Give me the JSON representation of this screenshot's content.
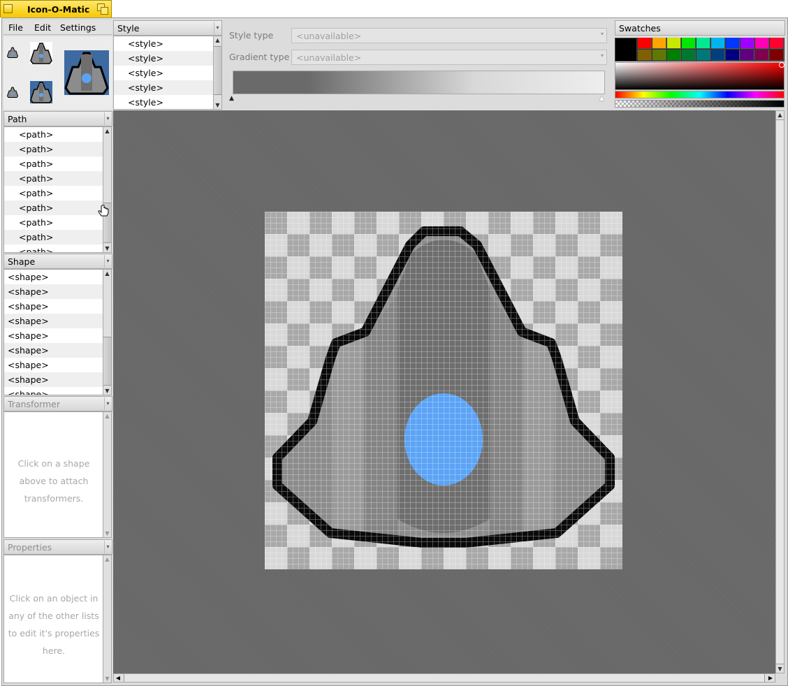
{
  "window": {
    "title": "Icon-O-Matic"
  },
  "menu": {
    "file": "File",
    "edit": "Edit",
    "settings": "Settings"
  },
  "style_list": {
    "header": "Style",
    "items": [
      "<style>",
      "<style>",
      "<style>",
      "<style>",
      "<style>"
    ]
  },
  "style_panel": {
    "style_type_label": "Style type",
    "style_type_value": "<unavailable>",
    "gradient_type_label": "Gradient type",
    "gradient_type_value": "<unavailable>"
  },
  "swatches": {
    "header": "Swatches",
    "row1": [
      "#000000",
      "#ff0000",
      "#ffa500",
      "#c8e800",
      "#00e800",
      "#00e890",
      "#00b4f0",
      "#0038ff",
      "#a000ff",
      "#ff00b4",
      "#ff0030"
    ],
    "row2": [
      "#000000",
      "#806000",
      "#607800",
      "#008000",
      "#007830",
      "#007878",
      "#004080",
      "#000080",
      "#600080",
      "#800050",
      "#800000"
    ]
  },
  "path_list": {
    "header": "Path",
    "items": [
      "<path>",
      "<path>",
      "<path>",
      "<path>",
      "<path>",
      "<path>",
      "<path>",
      "<path>",
      "<path>"
    ]
  },
  "shape_list": {
    "header": "Shape",
    "items": [
      "<shape>",
      "<shape>",
      "<shape>",
      "<shape>",
      "<shape>",
      "<shape>",
      "<shape>",
      "<shape>",
      "<shape>"
    ]
  },
  "transformer": {
    "header": "Transformer",
    "hint": "Click on a shape above to attach transformers."
  },
  "properties": {
    "header": "Properties",
    "hint": "Click on an object in any of the other lists to edit it's properties here."
  },
  "colors": {
    "accent": "#f6c800",
    "canvas": "#676767",
    "icon_body": "#8c8c8c",
    "icon_center": "#6e6e6e",
    "icon_window": "#5ba3f5",
    "icon_outline": "#000000"
  }
}
